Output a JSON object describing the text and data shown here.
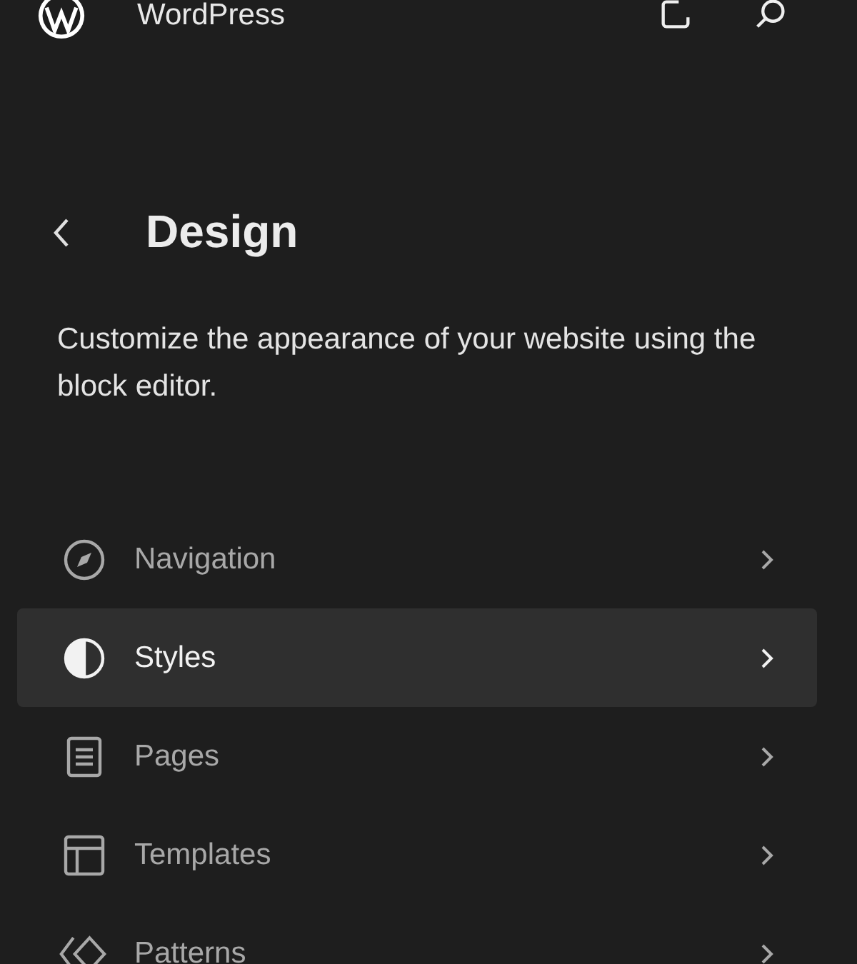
{
  "header": {
    "site_name": "WordPress"
  },
  "panel": {
    "title": "Design",
    "description": "Customize the appearance of your website using the block editor."
  },
  "menu": [
    {
      "label": "Navigation",
      "kind": "navigation",
      "selected": false
    },
    {
      "label": "Styles",
      "kind": "styles",
      "selected": true
    },
    {
      "label": "Pages",
      "kind": "pages",
      "selected": false
    },
    {
      "label": "Templates",
      "kind": "templates",
      "selected": false
    },
    {
      "label": "Patterns",
      "kind": "patterns",
      "selected": false
    }
  ]
}
